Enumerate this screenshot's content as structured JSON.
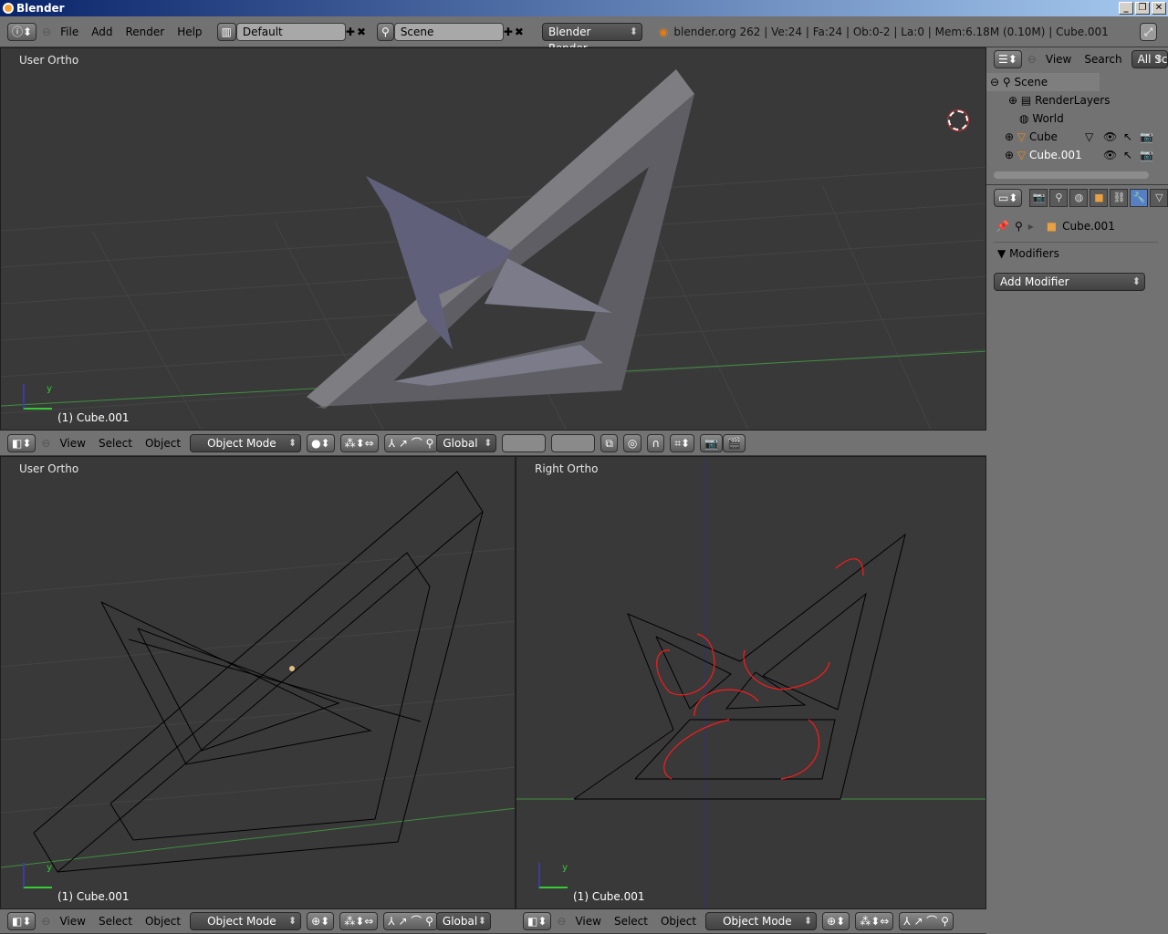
{
  "window": {
    "title": "Blender",
    "buttons": [
      "_",
      "❐",
      "✕"
    ]
  },
  "info_header": {
    "menus": [
      "File",
      "Add",
      "Render",
      "Help"
    ],
    "layout": "Default",
    "scene": "Scene",
    "engine": "Blender Render",
    "stats": "blender.org 262 | Ve:24 | Fa:24 | Ob:0-2 | La:0 | Mem:6.18M (0.10M) | Cube.001"
  },
  "viewports": {
    "top": {
      "label": "User Ortho",
      "object": "(1) Cube.001",
      "header": {
        "menus": [
          "View",
          "Select",
          "Object"
        ],
        "mode": "Object Mode",
        "orientation": "Global"
      }
    },
    "bottom_left": {
      "label": "User Ortho",
      "object": "(1) Cube.001",
      "header": {
        "menus": [
          "View",
          "Select",
          "Object"
        ],
        "mode": "Object Mode",
        "orientation": "Global"
      }
    },
    "bottom_right": {
      "label": "Right Ortho",
      "object": "(1) Cube.001",
      "header": {
        "menus": [
          "View",
          "Select",
          "Object"
        ],
        "mode": "Object Mode"
      }
    }
  },
  "outliner": {
    "menus": [
      "View",
      "Search"
    ],
    "filter": "All Scenes",
    "tree": [
      {
        "name": "Scene",
        "icon": "scene-icon",
        "level": 0
      },
      {
        "name": "RenderLayers",
        "icon": "renderlayers-icon",
        "level": 1
      },
      {
        "name": "World",
        "icon": "world-icon",
        "level": 1
      },
      {
        "name": "Cube",
        "icon": "mesh-icon",
        "level": 1
      },
      {
        "name": "Cube.001",
        "icon": "mesh-icon",
        "level": 1,
        "selected": true
      }
    ]
  },
  "properties": {
    "context_object": "Cube.001",
    "panel_title": "Modifiers",
    "add_modifier": "Add Modifier"
  },
  "colors": {
    "grid_x_axis": "#3f8f3f",
    "grid_z_axis": "#2f2f7f",
    "annotation": "#ff1a1a",
    "mesh": "#6e6e78"
  }
}
